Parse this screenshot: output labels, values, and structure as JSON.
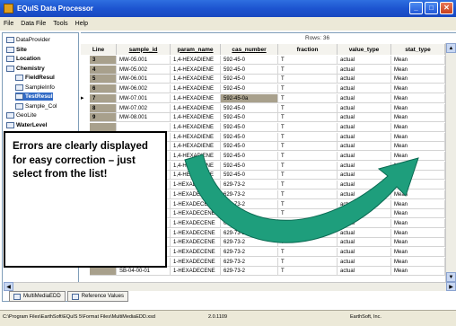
{
  "window": {
    "title": "EQuIS Data Processor"
  },
  "menu": [
    "File",
    "Data File",
    "Tools",
    "Help"
  ],
  "tree": {
    "items": [
      {
        "label": "DataProvider",
        "bold": false,
        "selected": false
      },
      {
        "label": "Site",
        "bold": true,
        "selected": false
      },
      {
        "label": "Location",
        "bold": true,
        "selected": false
      },
      {
        "label": "Chemistry",
        "bold": true,
        "selected": false
      },
      {
        "label": "FieldResul",
        "bold": true,
        "selected": false
      },
      {
        "label": "SampleInfo",
        "bold": false,
        "selected": false
      },
      {
        "label": "TestResul",
        "bold": true,
        "selected": true
      },
      {
        "label": "Sample_Col",
        "bold": false,
        "selected": false
      },
      {
        "label": "GeoLite",
        "bold": false,
        "selected": false
      },
      {
        "label": "WaterLevel",
        "bold": true,
        "selected": false
      }
    ]
  },
  "grid": {
    "rows_label": "Rows: 36",
    "columns": [
      "Line",
      "sample_id",
      "param_name",
      "cas_number",
      "fraction",
      "value_type",
      "stat_type"
    ],
    "rows": [
      {
        "line": "3",
        "sample_id": "MW-05.001",
        "param_name": "1,4-HEXADIENE",
        "cas_number": "592-45-0",
        "fraction": "T",
        "value_type": "actual",
        "stat_type": "Mean"
      },
      {
        "line": "4",
        "sample_id": "MW-05.002",
        "param_name": "1,4-HEXADIENE",
        "cas_number": "592-45-0",
        "fraction": "T",
        "value_type": "actual",
        "stat_type": "Mean"
      },
      {
        "line": "5",
        "sample_id": "MW-06.001",
        "param_name": "1,4-HEXADIENE",
        "cas_number": "592-45-0",
        "fraction": "T",
        "value_type": "actual",
        "stat_type": "Mean"
      },
      {
        "line": "6",
        "sample_id": "MW-06.002",
        "param_name": "1,4-HEXADIENE",
        "cas_number": "592-45-0",
        "fraction": "T",
        "value_type": "actual",
        "stat_type": "Mean"
      },
      {
        "line": "7",
        "sample_id": "MW-07.001",
        "param_name": "1,4-HEXADIENE",
        "cas_number": "592-45-0a",
        "fraction": "T",
        "value_type": "actual",
        "stat_type": "Mean",
        "error": true,
        "current": true
      },
      {
        "line": "8",
        "sample_id": "MW-07.002",
        "param_name": "1,4-HEXADIENE",
        "cas_number": "592-45-0",
        "fraction": "T",
        "value_type": "actual",
        "stat_type": "Mean"
      },
      {
        "line": "9",
        "sample_id": "MW-08.001",
        "param_name": "1,4-HEXADIENE",
        "cas_number": "592-45-0",
        "fraction": "T",
        "value_type": "actual",
        "stat_type": "Mean"
      },
      {
        "line": "",
        "sample_id": "",
        "param_name": "1,4-HEXADIENE",
        "cas_number": "592-45-0",
        "fraction": "T",
        "value_type": "actual",
        "stat_type": "Mean"
      },
      {
        "line": "",
        "sample_id": "",
        "param_name": "1,4-HEXADIENE",
        "cas_number": "592-45-0",
        "fraction": "T",
        "value_type": "actual",
        "stat_type": "Mean"
      },
      {
        "line": "",
        "sample_id": "",
        "param_name": "1,4-HEXADIENE",
        "cas_number": "592-45-0",
        "fraction": "T",
        "value_type": "actual",
        "stat_type": "Mean"
      },
      {
        "line": "",
        "sample_id": "",
        "param_name": "1,4-HEXADIENE",
        "cas_number": "592-45-0",
        "fraction": "T",
        "value_type": "actual",
        "stat_type": "Mean"
      },
      {
        "line": "",
        "sample_id": "",
        "param_name": "1,4-HEXADIENE",
        "cas_number": "592-45-0",
        "fraction": "T",
        "value_type": "actual",
        "stat_type": "Mean"
      },
      {
        "line": "",
        "sample_id": "",
        "param_name": "1,4-HEXADIENE",
        "cas_number": "592-45-0",
        "fraction": "T",
        "value_type": "actual",
        "stat_type": "Mean"
      },
      {
        "line": "",
        "sample_id": "",
        "param_name": "1-HEXADECENE",
        "cas_number": "629-73-2",
        "fraction": "T",
        "value_type": "actual",
        "stat_type": "Mean"
      },
      {
        "line": "",
        "sample_id": "",
        "param_name": "1-HEXADECENE",
        "cas_number": "629-73-2",
        "fraction": "T",
        "value_type": "actual",
        "stat_type": "Mean"
      },
      {
        "line": "",
        "sample_id": "",
        "param_name": "1-HEXADECENE",
        "cas_number": "629-73-2",
        "fraction": "T",
        "value_type": "actual",
        "stat_type": "Mean"
      },
      {
        "line": "",
        "sample_id": "",
        "param_name": "1-HEXADECENE",
        "cas_number": "629-73-2",
        "fraction": "T",
        "value_type": "actual",
        "stat_type": "Mean"
      },
      {
        "line": "",
        "sample_id": "",
        "param_name": "1-HEXADECENE",
        "cas_number": "629-73-2",
        "fraction": "T",
        "value_type": "actual",
        "stat_type": "Mean"
      },
      {
        "line": "",
        "sample_id": "",
        "param_name": "1-HEXADECENE",
        "cas_number": "629-73-2",
        "fraction": "T",
        "value_type": "actual",
        "stat_type": "Mean"
      },
      {
        "line": "",
        "sample_id": "",
        "param_name": "1-HEXADECENE",
        "cas_number": "629-73-2",
        "fraction": "T",
        "value_type": "actual",
        "stat_type": "Mean"
      },
      {
        "line": "",
        "sample_id": "",
        "param_name": "1-HEXADECENE",
        "cas_number": "629-73-2",
        "fraction": "T",
        "value_type": "actual",
        "stat_type": "Mean"
      },
      {
        "line": "",
        "sample_id": "",
        "param_name": "1-HEXADECENE",
        "cas_number": "629-73-2",
        "fraction": "T",
        "value_type": "actual",
        "stat_type": "Mean"
      },
      {
        "line": "",
        "sample_id": "SB-04-00-01",
        "param_name": "1-HEXADECENE",
        "cas_number": "629-73-2",
        "fraction": "T",
        "value_type": "actual",
        "stat_type": "Mean"
      }
    ]
  },
  "tabs": [
    "MultiMediaEDD",
    "Reference Values"
  ],
  "status": {
    "path": "C:\\Program Files\\EarthSoft\\EQuIS 5\\Format Files\\MultiMediaEDD.xsd",
    "version": "2.0.1109",
    "company": "EarthSoft, Inc."
  },
  "callout": {
    "text": "Errors are clearly displayed for easy correction – just select from the list!"
  },
  "colors": {
    "titlebar": "#1d54d0",
    "error_cell": "#a8a08c",
    "arrow": "#1e9e7c"
  }
}
